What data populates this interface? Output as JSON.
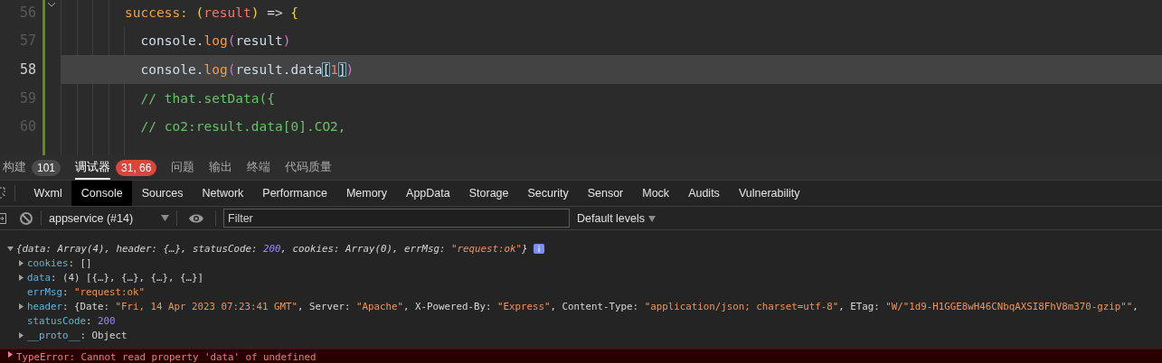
{
  "editor": {
    "lines": [
      {
        "number": "56",
        "selected": false,
        "expanded": true,
        "tokens": [
          {
            "kind": "key",
            "text": "success: "
          },
          {
            "kind": "paren",
            "text": "("
          },
          {
            "kind": "param",
            "text": "result"
          },
          {
            "kind": "paren",
            "text": ")"
          },
          {
            "kind": "plain",
            "text": " => "
          },
          {
            "kind": "paren",
            "text": "{"
          }
        ],
        "children": [
          {
            "number": "57",
            "selected": false,
            "tokens": [
              {
                "kind": "ident",
                "text": "console."
              },
              {
                "kind": "method",
                "text": "log"
              },
              {
                "kind": "paren2",
                "text": "("
              },
              {
                "kind": "ident",
                "text": "result"
              },
              {
                "kind": "paren2",
                "text": ")"
              }
            ]
          },
          {
            "number": "58",
            "selected": true,
            "tokens": [
              {
                "kind": "ident",
                "text": "console."
              },
              {
                "kind": "method",
                "text": "log"
              },
              {
                "kind": "paren2",
                "text": "("
              },
              {
                "kind": "ident",
                "text": "result.data"
              },
              {
                "kind": "match",
                "text": "["
              },
              {
                "kind": "number",
                "text": "1"
              },
              {
                "kind": "match",
                "text": "]"
              },
              {
                "kind": "paren2",
                "text": ")"
              }
            ]
          },
          {
            "number": "59",
            "selected": false,
            "tokens": [
              {
                "kind": "comment",
                "text": "// that.setData({"
              }
            ]
          },
          {
            "number": "60",
            "selected": false,
            "tokens": [
              {
                "kind": "comment",
                "text": "// co2:result.data[0].CO2,"
              }
            ]
          }
        ]
      }
    ]
  },
  "panel_tabs": [
    {
      "label": "构建",
      "selected": false,
      "badge": {
        "text": "101",
        "color": "#4a4a4a"
      }
    },
    {
      "label": "调试器",
      "selected": true,
      "badge": {
        "text": "31, 66",
        "color": "#d8463d"
      }
    },
    {
      "label": "问题",
      "selected": false
    },
    {
      "label": "输出",
      "selected": false
    },
    {
      "label": "终端",
      "selected": false
    },
    {
      "label": "代码质量",
      "selected": false
    }
  ],
  "devtools_tabs": [
    {
      "label": "Wxml",
      "selected": false
    },
    {
      "label": "Console",
      "selected": true
    },
    {
      "label": "Sources",
      "selected": false
    },
    {
      "label": "Network",
      "selected": false
    },
    {
      "label": "Performance",
      "selected": false
    },
    {
      "label": "Memory",
      "selected": false
    },
    {
      "label": "AppData",
      "selected": false
    },
    {
      "label": "Storage",
      "selected": false
    },
    {
      "label": "Security",
      "selected": false
    },
    {
      "label": "Sensor",
      "selected": false
    },
    {
      "label": "Mock",
      "selected": false
    },
    {
      "label": "Audits",
      "selected": false
    },
    {
      "label": "Vulnerability",
      "selected": false
    }
  ],
  "toolbar": {
    "context": "appservice (#14)",
    "filter": {
      "placeholder": "Filter"
    },
    "levels": "Default levels"
  },
  "console": [
    {
      "kind": "object",
      "expanded": true,
      "segments": [
        {
          "kind": "plain",
          "text": "{data: Array(4), header: {…}, statusCode: "
        },
        {
          "kind": "number",
          "text": "200"
        },
        {
          "kind": "plain",
          "text": ", cookies: Array(0), errMsg: "
        },
        {
          "kind": "string",
          "text": "\"request:ok\""
        },
        {
          "kind": "plain",
          "text": "}"
        }
      ],
      "children": [
        {
          "key": "cookies",
          "expandable": true,
          "expanded": false,
          "value": [
            {
              "kind": "plain",
              "text": ": []"
            }
          ]
        },
        {
          "key": "data",
          "expandable": true,
          "expanded": false,
          "value": [
            {
              "kind": "plain",
              "text": ": (4) [{…}, {…}, {…}, {…}]"
            }
          ]
        },
        {
          "key": "errMsg",
          "expandable": false,
          "value": [
            {
              "kind": "plain",
              "text": ": "
            },
            {
              "kind": "string",
              "text": "\"request:ok\""
            }
          ]
        },
        {
          "key": "header",
          "expandable": true,
          "expanded": false,
          "value": [
            {
              "kind": "plain",
              "text": ": {Date: "
            },
            {
              "kind": "string",
              "text": "\"Fri, 14 Apr 2023 07:23:41 GMT\""
            },
            {
              "kind": "plain",
              "text": ", Server: "
            },
            {
              "kind": "string",
              "text": "\"Apache\""
            },
            {
              "kind": "plain",
              "text": ", X-Powered-By: "
            },
            {
              "kind": "string",
              "text": "\"Express\""
            },
            {
              "kind": "plain",
              "text": ", Content-Type: "
            },
            {
              "kind": "string",
              "text": "\"application/json; charset=utf-8\""
            },
            {
              "kind": "plain",
              "text": ", ETag: "
            },
            {
              "kind": "string",
              "text": "\"W/\"1d9-H1GGE8wH46CNbqAXSI8FhV8m370-gzip\"\""
            },
            {
              "kind": "plain",
              "text": ","
            }
          ]
        },
        {
          "key": "statusCode",
          "expandable": false,
          "value": [
            {
              "kind": "plain",
              "text": ": "
            },
            {
              "kind": "number",
              "text": "200"
            }
          ]
        },
        {
          "key": "__proto__",
          "kind": "proto",
          "expandable": true,
          "expanded": false,
          "value": [
            {
              "kind": "plain",
              "text": ": Object"
            }
          ]
        }
      ]
    },
    {
      "kind": "error",
      "expanded": false,
      "text": "TypeError: Cannot read property 'data' of undefined"
    }
  ]
}
